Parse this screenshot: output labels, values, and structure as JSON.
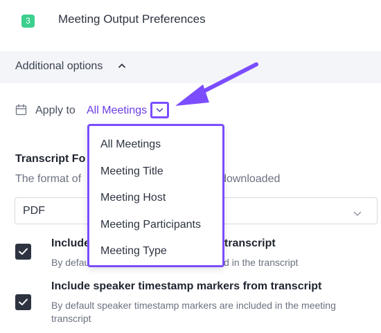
{
  "step": {
    "number": "3",
    "title": "Meeting Output Preferences"
  },
  "additional_options": {
    "label": "Additional options",
    "icon": "chevron-up-icon"
  },
  "apply_to": {
    "label": "Apply to",
    "value": "All Meetings",
    "icon": "calendar-icon",
    "toggle_icon": "chevron-down-icon"
  },
  "dropdown": {
    "options": [
      "All Meetings",
      "Meeting Title",
      "Meeting Host",
      "Meeting Participants",
      "Meeting Type"
    ]
  },
  "transcript_format": {
    "title": "Transcript Fo",
    "description_start": "The format of",
    "description_end": "downloaded",
    "select_value": "PDF"
  },
  "options": [
    {
      "checked": true,
      "title_start": "Include",
      "title_end": "transcript",
      "desc_start": "By defau",
      "desc_end": "d in the transcript"
    },
    {
      "checked": true,
      "title": "Include speaker timestamp markers from transcript",
      "desc": "By default speaker timestamp markers are included in the meeting transcript"
    }
  ],
  "colors": {
    "accent": "#7b4dff",
    "link": "#6b3de8",
    "badge": "#3ccf8e",
    "checkbox": "#2d3340"
  }
}
